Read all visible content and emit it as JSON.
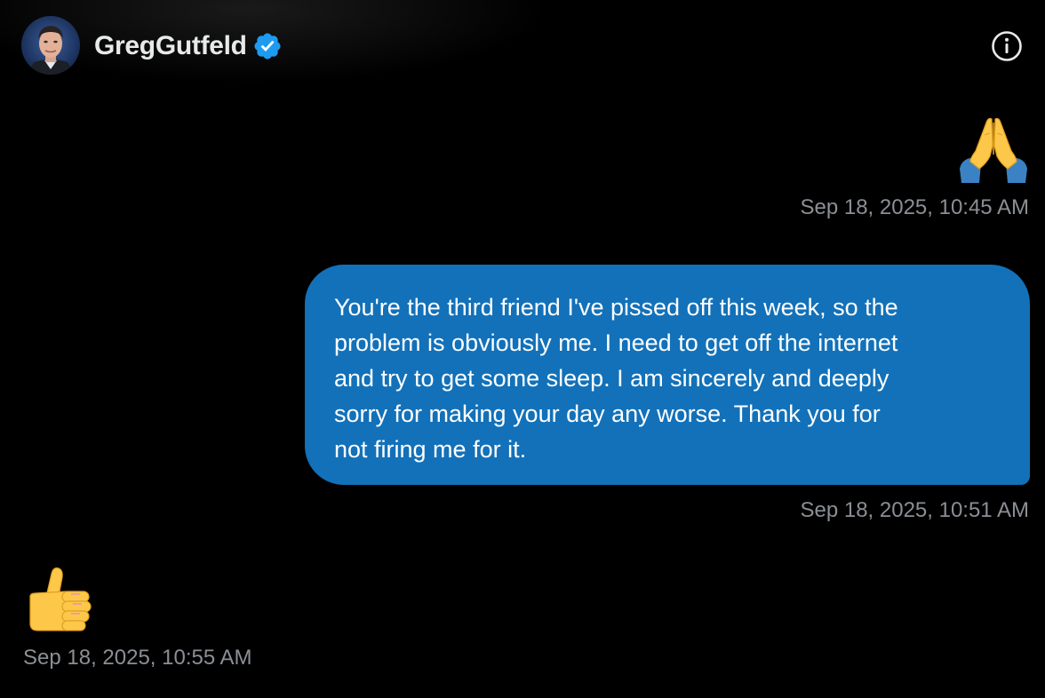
{
  "header": {
    "name": "GregGutfeld",
    "verified": true,
    "info_icon": "info-circle-icon"
  },
  "colors": {
    "background": "#000000",
    "bubble": "#1271b9",
    "verified": "#1d9bf0",
    "timestamp": "#8b8f94"
  },
  "messages": [
    {
      "side": "right",
      "type": "emoji",
      "emoji_name": "folded-hands",
      "timestamp": "Sep 18, 2025, 10:45 AM"
    },
    {
      "side": "right",
      "type": "text",
      "lines": [
        "You're the third friend I've pissed off this week, so the",
        "problem is obviously me. I need to get off the internet",
        "and try to get some sleep. I am sincerely and deeply",
        "sorry for making your day any worse. Thank you for",
        "not firing me for it."
      ],
      "timestamp": "Sep 18, 2025, 10:51 AM"
    },
    {
      "side": "left",
      "type": "emoji",
      "emoji_name": "thumbs-up",
      "timestamp": "Sep 18, 2025, 10:55 AM"
    }
  ]
}
